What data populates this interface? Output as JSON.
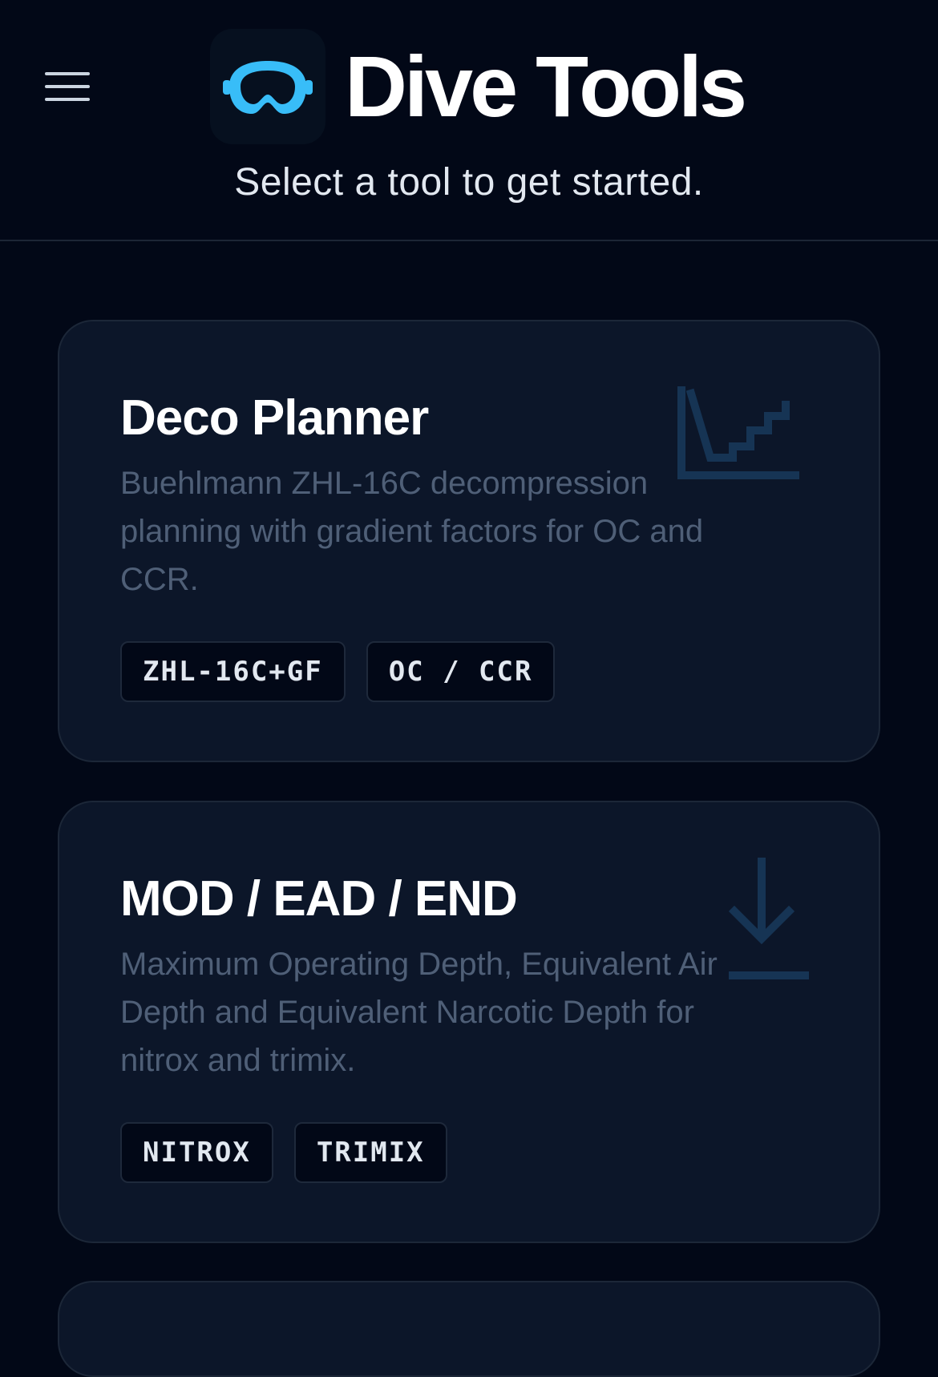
{
  "header": {
    "menu_icon": "hamburger-menu-icon",
    "logo_icon": "dive-mask-icon",
    "title": "Dive Tools",
    "subtitle": "Select a tool to get started."
  },
  "tools": [
    {
      "title": "Deco Planner",
      "description": "Buehlmann ZHL-16C decompression planning with gradient factors for OC and CCR.",
      "icon": "deco-profile-chart-icon",
      "tags": [
        "ZHL-16C+GF",
        "OC / CCR"
      ]
    },
    {
      "title": "MOD / EAD / END",
      "description": "Maximum Operating Depth, Equivalent Air Depth and Equivalent Narcotic Depth for nitrox and trimix.",
      "icon": "depth-arrow-down-icon",
      "tags": [
        "NITROX",
        "TRIMIX"
      ]
    }
  ],
  "colors": {
    "background": "#020817",
    "card": "#0c1629",
    "accent": "#38bdf8",
    "muted_text": "#4f5f77"
  }
}
